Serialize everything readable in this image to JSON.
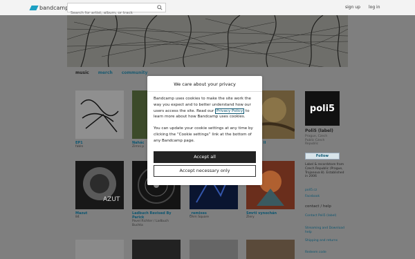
{
  "header": {
    "logo_text": "bandcamp",
    "search_placeholder": "Search for artist, album, or track",
    "signup": "sign up",
    "login": "log in"
  },
  "tabs": [
    "music",
    "merch",
    "community"
  ],
  "albums": [
    {
      "title": "EP1",
      "artist": "fabln",
      "cover": "sketch"
    },
    {
      "title": "Nahác",
      "artist": "Zimní p",
      "cover": "green"
    },
    {
      "title": "",
      "artist": "",
      "cover": "hidden"
    },
    {
      "title": "or světa II",
      "artist": "",
      "cover": "warm"
    },
    {
      "title": "Mazut",
      "artist": "84",
      "cover": "mazut"
    },
    {
      "title": "Ladbuch Revised By Parick",
      "artist": "Pavel Richter / Ladbuch Buchta",
      "cover": "vinyl"
    },
    {
      "title": "_remixes",
      "artist": "Ohm Square",
      "cover": "blue"
    },
    {
      "title": "Smrti vynochán",
      "artist": "Zlery",
      "cover": "red"
    }
  ],
  "label": {
    "logo": "poli5",
    "name": "Poli5 (label)",
    "sub_lines": [
      "Prague, Czech",
      "Public Czech",
      "Republic"
    ],
    "follow": "Follow",
    "bio": "Label & recordstore from Czech Republic (Prague, Trojanova 8). Established in 2006",
    "links": [
      "poli5.cz",
      "Facebook"
    ],
    "contact_head": "contact / help",
    "contact_links": [
      "Contact Poli5 (label)",
      "Streaming and Download help",
      "Shipping and returns",
      "Redeem code"
    ]
  },
  "cookie": {
    "title": "We care about your privacy",
    "p1_before": "Bandcamp uses cookies to make the site work the way you expect and to better understand how our users access the site. Read our ",
    "privacy_link": "Privacy Policy",
    "p1_after": " to learn more about how Bandcamp uses cookies.",
    "p2": "You can update your cookie settings at any time by clicking the “Cookie settings” link at the bottom of any Bandcamp page.",
    "accept_all": "Accept all",
    "accept_necessary": "Accept necessary only"
  }
}
